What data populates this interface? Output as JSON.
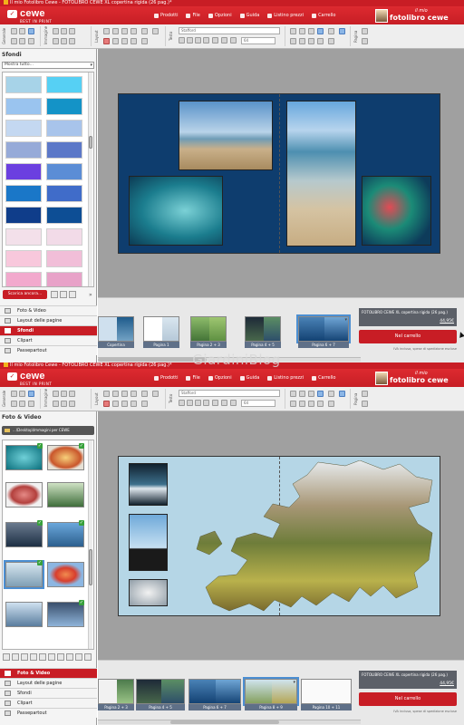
{
  "window_title": "Il mio Fotolibro Cewe - FOTOLIBRO CEWE XL copertina rigida (26 pag.)*",
  "brand": {
    "logo_word": "cewe",
    "logo_tagline": "BEST IN PRINT",
    "product_tag": "il mio",
    "product_name": "fotolibro cewe"
  },
  "menu": [
    {
      "label": "Prodotti",
      "icon": "products-icon"
    },
    {
      "label": "File",
      "icon": "folder-icon"
    },
    {
      "label": "Opzioni",
      "icon": "gear-icon"
    },
    {
      "label": "Guida",
      "icon": "help-icon"
    },
    {
      "label": "Listino prezzi",
      "icon": "price-list-icon"
    },
    {
      "label": "Carrello",
      "icon": "cart-icon"
    }
  ],
  "toolbar": {
    "group_labels": [
      "Generale",
      "Immagine",
      "Layout",
      "Testo",
      "Pagina"
    ],
    "font_name": "Stafford",
    "font_size": "64"
  },
  "screen1": {
    "panel_title": "Sfondi",
    "filter_value": "Mostra tutto...",
    "swatch_colors": [
      "#a7d3e8",
      "#56d0f4",
      "#9ac4ef",
      "#1493c7",
      "#c4d8f1",
      "#a8c4eb",
      "#96aad8",
      "#5c78c8",
      "#6b3fe0",
      "#5b8dd6",
      "#1a77c8",
      "#406cc9",
      "#0f3d8a",
      "#0d4e95",
      "#f3e0ea",
      "#f2dbe8",
      "#f8c8dc",
      "#f1bed8",
      "#f2a9cd",
      "#e8a2c8"
    ],
    "download_button": "Scarica ancora...",
    "nav": [
      {
        "label": "Foto & Video",
        "active": false
      },
      {
        "label": "Layout delle pagine",
        "active": false
      },
      {
        "label": "Sfondi",
        "active": true
      },
      {
        "label": "Clipart",
        "active": false
      },
      {
        "label": "Passepartout",
        "active": false
      }
    ],
    "background_color": "#0e3d6e",
    "pages": [
      "Copertina",
      "Pagina 1",
      "Pagina 2 + 3",
      "Pagina 4 + 5",
      "Pagina 6 + 7"
    ],
    "selected_page": "Pagina 6 + 7"
  },
  "screen2": {
    "panel_title": "Foto & Video",
    "folder_path": "...\\Desktop\\Immagini per CEWE",
    "nav": [
      {
        "label": "Foto & Video",
        "active": true
      },
      {
        "label": "Layout delle pagine",
        "active": false
      },
      {
        "label": "Sfondi",
        "active": false
      },
      {
        "label": "Clipart",
        "active": false
      },
      {
        "label": "Passepartout",
        "active": false
      }
    ],
    "background_color": "#b5d6e6",
    "pages": [
      "Pagina 2 + 3",
      "Pagina 4 + 5",
      "Pagina 6 + 7",
      "Pagina 8 + 9",
      "Pagina 10 + 11"
    ],
    "selected_page": "Pagina 8 + 9"
  },
  "order": {
    "product": "FOTOLIBRO CEWE XL copertina rigida (26 pag.)",
    "price": "44,95€",
    "cart_button": "Nel carrello",
    "note": "IVA inclusa, spese di spedizione escluse"
  },
  "watermark": "GiardiniBlog"
}
